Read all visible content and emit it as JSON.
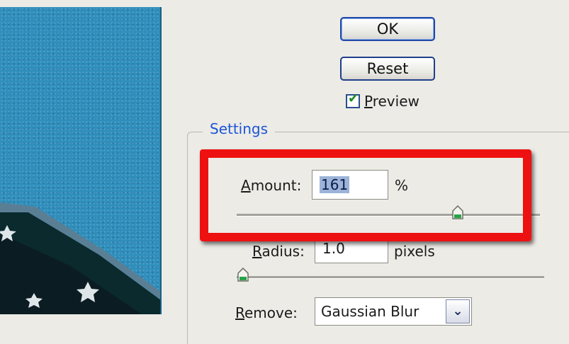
{
  "dialog": {
    "ok_label": "OK",
    "reset_label": "Reset",
    "preview": {
      "label_first": "P",
      "label_rest": "review",
      "checked": true
    }
  },
  "settings": {
    "legend": "Settings",
    "amount": {
      "label_first": "A",
      "label_rest": "mount:",
      "value": "161",
      "unit": "%",
      "slider_fraction": 0.73
    },
    "radius": {
      "label_first": "R",
      "label_rest": "adius:",
      "value": "1.0",
      "unit": "pixels",
      "slider_fraction": 0.02
    },
    "remove": {
      "label_first": "R",
      "label_rest": "emove:",
      "value": "Gaussian Blur"
    }
  },
  "colors": {
    "highlight": "#ee1111",
    "legend": "#1d55d6",
    "preview_sky": "#2f8ebb"
  }
}
